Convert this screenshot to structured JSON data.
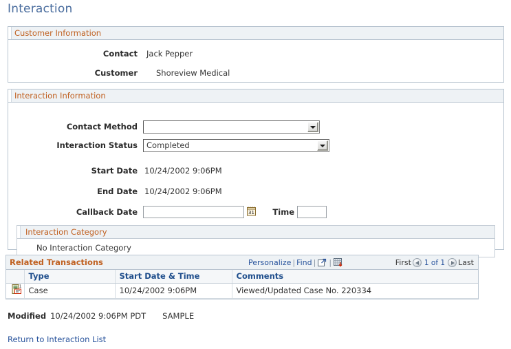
{
  "page": {
    "title": "Interaction"
  },
  "customer_information": {
    "legend": "Customer Information",
    "fields": [
      {
        "label": "Contact",
        "value": "Jack Pepper"
      },
      {
        "label": "Customer",
        "value": "Shoreview Medical"
      }
    ]
  },
  "interaction_information": {
    "legend": "Interaction Information",
    "contact_method": {
      "label": "Contact Method",
      "value": "",
      "icon": "chevron-down-icon"
    },
    "interaction_status": {
      "label": "Interaction Status",
      "value": "Completed",
      "icon": "chevron-down-icon"
    },
    "start_date": {
      "label": "Start Date",
      "value": "10/24/2002  9:06PM"
    },
    "end_date": {
      "label": "End Date",
      "value": "10/24/2002  9:06PM"
    },
    "callback_date": {
      "label": "Callback Date",
      "value": "",
      "placeholder": "",
      "icon": "calendar-icon"
    },
    "time": {
      "label": "Time",
      "value": "",
      "placeholder": ""
    },
    "interaction_category": {
      "legend": "Interaction Category",
      "empty_text": "No Interaction Category"
    }
  },
  "related_transactions": {
    "legend": "Related Transactions",
    "tools": {
      "personalize": "Personalize",
      "find": "Find",
      "separator": "|",
      "download_icon": "new-window-icon",
      "grid_icon": "download-to-excel-icon"
    },
    "nav": {
      "first": "First",
      "prev_icon": "arrow-left-circle-icon",
      "counter": "1 of 1",
      "next_icon": "arrow-right-circle-icon",
      "last": "Last"
    },
    "columns": [
      "",
      "Type",
      "Start Date & Time",
      "Comments"
    ],
    "rows": [
      {
        "icon": "transaction-detail-icon",
        "type": "Case",
        "start_date_time": "10/24/2002  9:06PM",
        "comments": "Viewed/Updated Case No. 220334"
      }
    ]
  },
  "footer": {
    "modified_label": "Modified",
    "modified_value": "10/24/2002  9:06PM PDT",
    "modified_user": "SAMPLE",
    "return_link": "Return to Interaction List"
  },
  "colors": {
    "title": "#4a6d9e",
    "legend": "#c06020",
    "link": "#28539c",
    "column_header": "#1f4e8c",
    "panel_header_bg": "#eef2f5",
    "panel_border": "#b8c4d0"
  }
}
